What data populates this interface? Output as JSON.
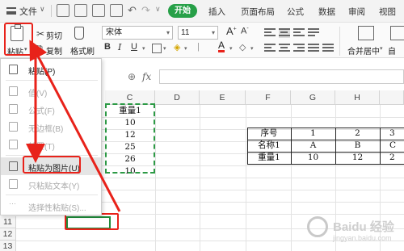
{
  "menubar": {
    "file_label": "文件",
    "start_tab": "开始",
    "tabs": [
      "插入",
      "页面布局",
      "公式",
      "数据",
      "审阅",
      "视图"
    ]
  },
  "ribbon": {
    "paste_label": "粘贴",
    "cut_label": "剪切",
    "copy_label": "复制",
    "format_painter_label": "格式刷",
    "font_name": "宋体",
    "font_size": "11",
    "merge_label": "合并居中",
    "wrap_label": "自"
  },
  "paste_menu": {
    "items": [
      {
        "label": "粘贴(P)",
        "enabled": true
      },
      {
        "label": "值(V)",
        "enabled": false
      },
      {
        "label": "公式(F)",
        "enabled": false
      },
      {
        "label": "无边框(B)",
        "enabled": false
      },
      {
        "label": "转置(T)",
        "enabled": false
      },
      {
        "label": "粘贴为图片(U)",
        "enabled": true
      },
      {
        "label": "只粘贴文本(Y)",
        "enabled": false
      },
      {
        "label": "选择性粘贴(S)...",
        "enabled": false
      }
    ]
  },
  "formula_bar": {
    "fx_label": "fx",
    "value": ""
  },
  "columns": [
    "C",
    "D",
    "E",
    "F",
    "G",
    "H"
  ],
  "rows": [
    "11",
    "12",
    "13"
  ],
  "copied_range": [
    "重量1",
    "10",
    "12",
    "25",
    "26",
    "10"
  ],
  "table": {
    "rows": [
      [
        "序号",
        "1",
        "2",
        "3"
      ],
      [
        "名称1",
        "A",
        "B",
        "C"
      ],
      [
        "重量1",
        "10",
        "12",
        "2"
      ]
    ]
  },
  "watermark": {
    "text": "Baidu 经验",
    "url": "jingyan.baidu.com"
  },
  "colors": {
    "accent_green": "#27a048",
    "highlight_red": "#e8221a"
  }
}
